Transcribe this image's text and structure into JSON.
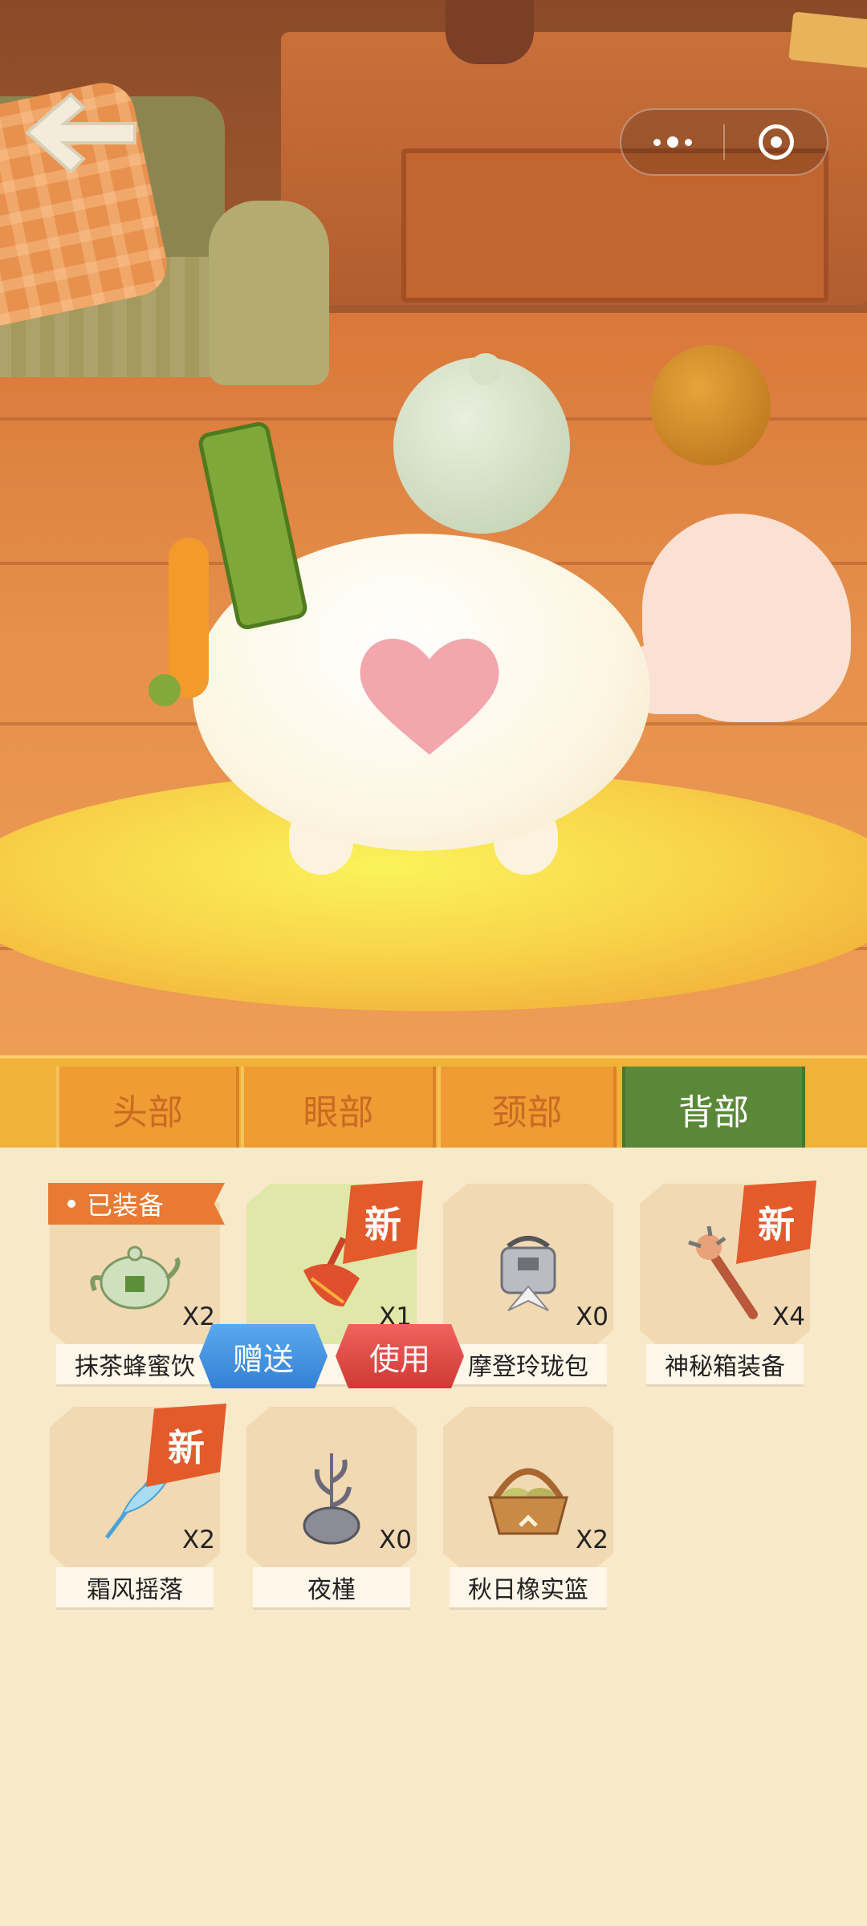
{
  "tabs": [
    {
      "label": "头部",
      "active": false
    },
    {
      "label": "眼部",
      "active": false
    },
    {
      "label": "颈部",
      "active": false
    },
    {
      "label": "背部",
      "active": true
    }
  ],
  "equipped_badge": "已装备",
  "new_badge": "新",
  "items": [
    {
      "name": "抹茶蜂蜜饮",
      "count": "X2",
      "equipped": true,
      "new": false,
      "icon": "matcha-teapot-icon"
    },
    {
      "name": "",
      "count": "X1",
      "equipped": false,
      "new": true,
      "selected": true,
      "icon": "red-dustpan-icon"
    },
    {
      "name": "摩登玲珑包",
      "count": "X0",
      "equipped": false,
      "new": false,
      "icon": "silver-bag-icon"
    },
    {
      "name": "神秘箱装备",
      "count": "X4",
      "equipped": false,
      "new": true,
      "icon": "spiked-club-icon"
    },
    {
      "name": "霜风摇落",
      "count": "X2",
      "equipped": false,
      "new": true,
      "icon": "ice-feather-icon"
    },
    {
      "name": "夜槿",
      "count": "X0",
      "equipped": false,
      "new": false,
      "icon": "potted-plant-icon"
    },
    {
      "name": "秋日橡实篮",
      "count": "X2",
      "equipped": false,
      "new": false,
      "icon": "acorn-basket-icon"
    }
  ],
  "actions": {
    "gift": "赠送",
    "use": "使用"
  },
  "colors": {
    "active_tab": "#5b8838",
    "tab": "#ef9c34",
    "new_tag": "#e35a2b",
    "gift": "#3f8fe0",
    "use": "#dd4742"
  }
}
